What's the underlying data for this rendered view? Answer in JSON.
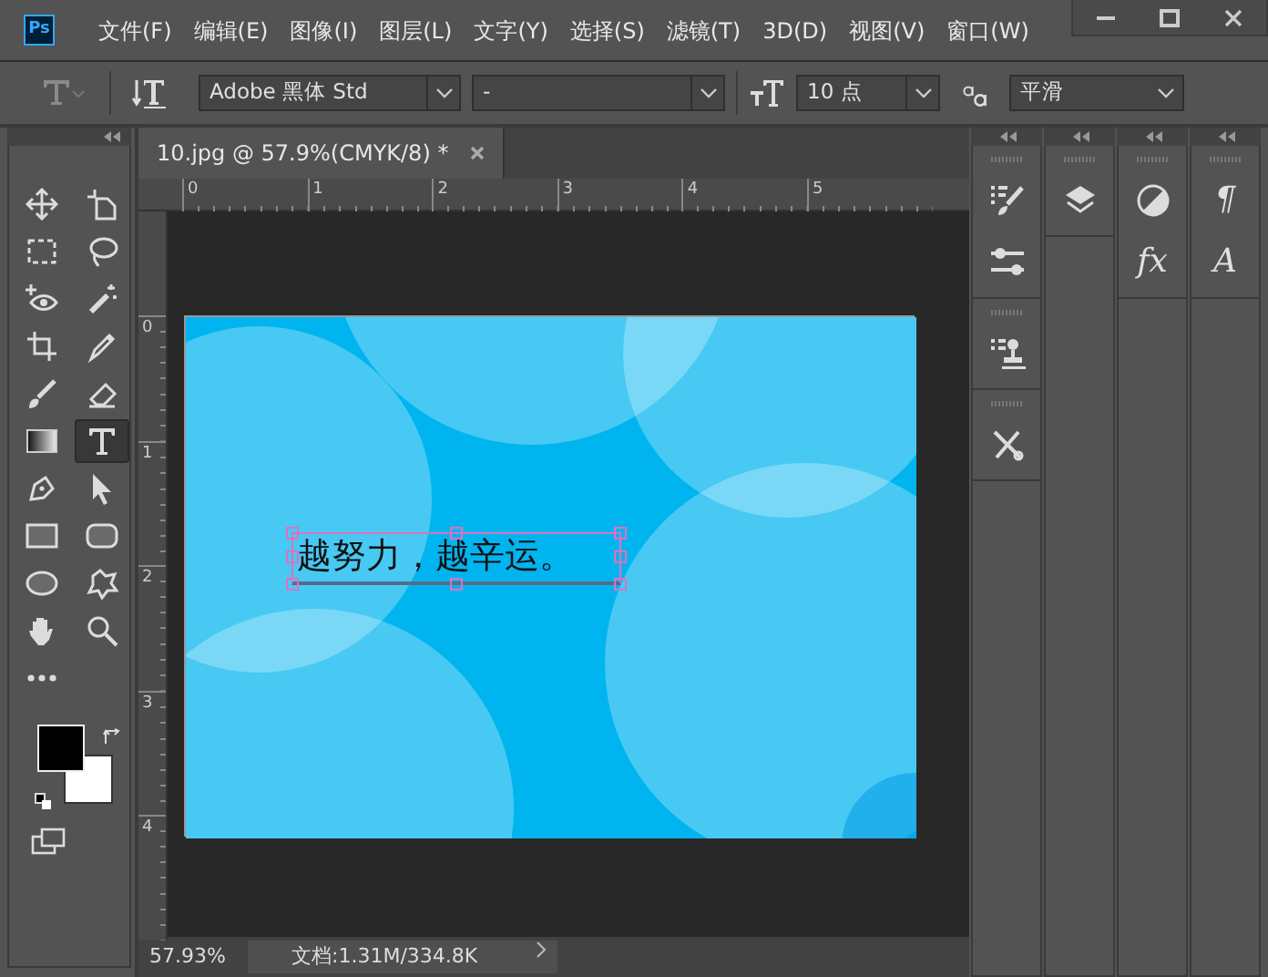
{
  "app_logo": "Ps",
  "menu": [
    "文件(F)",
    "编辑(E)",
    "图像(I)",
    "图层(L)",
    "文字(Y)",
    "选择(S)",
    "滤镜(T)",
    "3D(D)",
    "视图(V)",
    "窗口(W)"
  ],
  "options_bar": {
    "font_family": "Adobe 黑体 Std",
    "font_style": "-",
    "font_size": "10 点",
    "antialias": "平滑"
  },
  "tools": [
    {
      "kind": "move",
      "selected": false
    },
    {
      "kind": "artboard",
      "selected": false
    },
    {
      "kind": "marquee",
      "selected": false
    },
    {
      "kind": "lasso",
      "selected": false
    },
    {
      "kind": "eye",
      "selected": false
    },
    {
      "kind": "wand",
      "selected": false
    },
    {
      "kind": "crop",
      "selected": false
    },
    {
      "kind": "eyedropper",
      "selected": false
    },
    {
      "kind": "brush",
      "selected": false
    },
    {
      "kind": "eraser",
      "selected": false
    },
    {
      "kind": "gradient",
      "selected": false
    },
    {
      "kind": "type",
      "selected": true
    },
    {
      "kind": "pen",
      "selected": false
    },
    {
      "kind": "arrow",
      "selected": false
    },
    {
      "kind": "rect",
      "selected": false
    },
    {
      "kind": "roundrect",
      "selected": false
    },
    {
      "kind": "ellipse",
      "selected": false
    },
    {
      "kind": "shape",
      "selected": false
    },
    {
      "kind": "hand",
      "selected": false
    },
    {
      "kind": "zoom",
      "selected": false
    },
    {
      "kind": "more",
      "selected": false
    }
  ],
  "document_tab": {
    "title": "10.jpg @ 57.9%(CMYK/8) *"
  },
  "ruler_horizontal": [
    "0",
    "1",
    "2",
    "3",
    "4",
    "5"
  ],
  "ruler_vertical": [
    "0",
    "1",
    "2",
    "3",
    "4"
  ],
  "canvas_text": "越努力，越辛运。",
  "status_bar": {
    "zoom": "57.93%",
    "document_info": "文档:1.31M/334.8K"
  },
  "panel_dock": [
    {
      "groups": [
        [
          {
            "kind": "brush-list"
          },
          {
            "kind": "sliders"
          }
        ],
        [
          {
            "kind": "stamp-list"
          }
        ],
        [
          {
            "kind": "tools"
          }
        ]
      ]
    },
    {
      "groups": [
        [
          {
            "kind": "layers"
          }
        ]
      ]
    },
    {
      "groups": [
        [
          {
            "kind": "adjust"
          },
          {
            "kind": "glyph",
            "text": "fx"
          }
        ]
      ]
    },
    {
      "groups": [
        [
          {
            "kind": "glyph",
            "text": "¶"
          },
          {
            "kind": "glyph",
            "text": "A"
          }
        ]
      ]
    }
  ]
}
